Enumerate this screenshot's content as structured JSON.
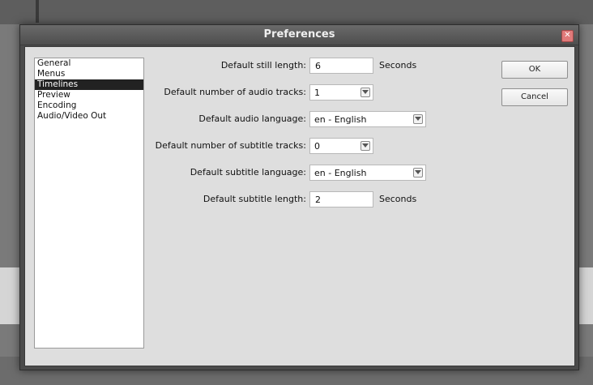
{
  "window": {
    "title": "Preferences",
    "close_icon": "close-icon"
  },
  "sidebar": {
    "items": [
      {
        "label": "General"
      },
      {
        "label": "Menus"
      },
      {
        "label": "Timelines",
        "selected": true
      },
      {
        "label": "Preview"
      },
      {
        "label": "Encoding"
      },
      {
        "label": "Audio/Video Out"
      }
    ]
  },
  "form": {
    "still_length": {
      "label": "Default still length:",
      "value": "6",
      "unit": "Seconds"
    },
    "audio_tracks": {
      "label": "Default number of audio tracks:",
      "value": "1"
    },
    "audio_language": {
      "label": "Default audio language:",
      "value": "en - English"
    },
    "subtitle_tracks": {
      "label": "Default number of subtitle tracks:",
      "value": "0"
    },
    "subtitle_language": {
      "label": "Default subtitle language:",
      "value": "en - English"
    },
    "subtitle_length": {
      "label": "Default subtitle length:",
      "value": "2",
      "unit": "Seconds"
    }
  },
  "buttons": {
    "ok": "OK",
    "cancel": "Cancel"
  }
}
